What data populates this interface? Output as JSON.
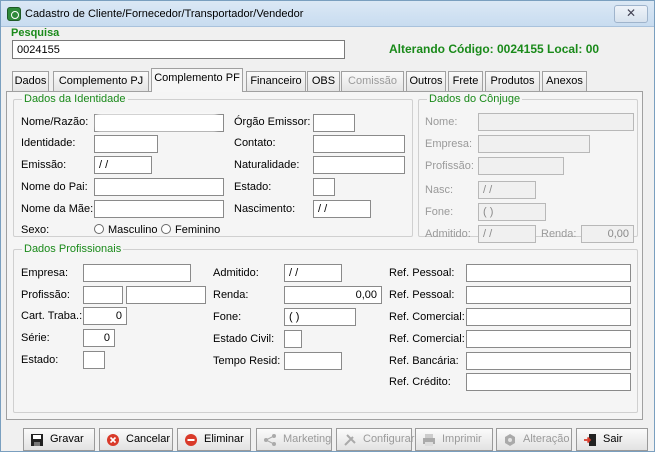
{
  "window": {
    "title": "Cadastro de Cliente/Fornecedor/Transportador/Vendedor",
    "close_glyph": "✕"
  },
  "search": {
    "label": "Pesquisa",
    "value": "0024155"
  },
  "status": {
    "text": "Alterando Código: 0024155   Local: 00"
  },
  "tabs": [
    {
      "label": "Dados"
    },
    {
      "label": "Complemento PJ"
    },
    {
      "label": "Complemento PF"
    },
    {
      "label": "Financeiro"
    },
    {
      "label": "OBS"
    },
    {
      "label": "Comissão"
    },
    {
      "label": "Outros"
    },
    {
      "label": "Frete"
    },
    {
      "label": "Produtos"
    },
    {
      "label": "Anexos"
    }
  ],
  "identidade": {
    "title": "Dados da Identidade",
    "nome_razao_label": "Nome/Razão:",
    "identidade_label": "Identidade:",
    "emissao_label": "Emissão:",
    "emissao_value": " / /",
    "nome_pai_label": "Nome do Pai:",
    "nome_mae_label": "Nome da Mãe:",
    "sexo_label": "Sexo:",
    "masculino_label": "Masculino",
    "feminino_label": "Feminino",
    "orgao_label": "Órgão Emissor:",
    "contato_label": "Contato:",
    "naturalidade_label": "Naturalidade:",
    "estado_label": "Estado:",
    "nascimento_label": "Nascimento:",
    "nascimento_value": " / /"
  },
  "conjuge": {
    "title": "Dados do Cônjuge",
    "nome_label": "Nome:",
    "empresa_label": "Empresa:",
    "profissao_label": "Profissão:",
    "nasc_label": "Nasc:",
    "nasc_value": " / /",
    "fone_label": "Fone:",
    "fone_value": "(  )",
    "admitido_label": "Admitido:",
    "admitido_value": " / /",
    "renda_label": "Renda:",
    "renda_value": "0,00"
  },
  "profissionais": {
    "title": "Dados Profissionais",
    "empresa_label": "Empresa:",
    "profissao_label": "Profissão:",
    "cart_label": "Cart. Traba.:",
    "cart_value": "0",
    "serie_label": "Série:",
    "serie_value": "0",
    "estado_label": "Estado:",
    "admitido_label": "Admitido:",
    "admitido_value": " / /",
    "renda_label": "Renda:",
    "renda_value": "0,00",
    "fone_label": "Fone:",
    "fone_value": "(  )",
    "estado_civil_label": "Estado Civil:",
    "tempo_resid_label": "Tempo Resid:",
    "ref_pessoal_1_label": "Ref. Pessoal:",
    "ref_pessoal_2_label": "Ref. Pessoal:",
    "ref_comercial_1_label": "Ref. Comercial:",
    "ref_comercial_2_label": "Ref. Comercial:",
    "ref_bancaria_label": "Ref. Bancária:",
    "ref_credito_label": "Ref. Crédito:"
  },
  "toolbar": {
    "gravar": "Gravar",
    "cancelar": "Cancelar",
    "eliminar": "Eliminar",
    "marketing": "Marketing",
    "configurar": "Configurar",
    "imprimir": "Imprimir",
    "alteracao": "Alteração",
    "sair": "Sair"
  },
  "colors": {
    "accent_green": "#1a8a1a",
    "disabled_text": "#9a9a9a"
  }
}
